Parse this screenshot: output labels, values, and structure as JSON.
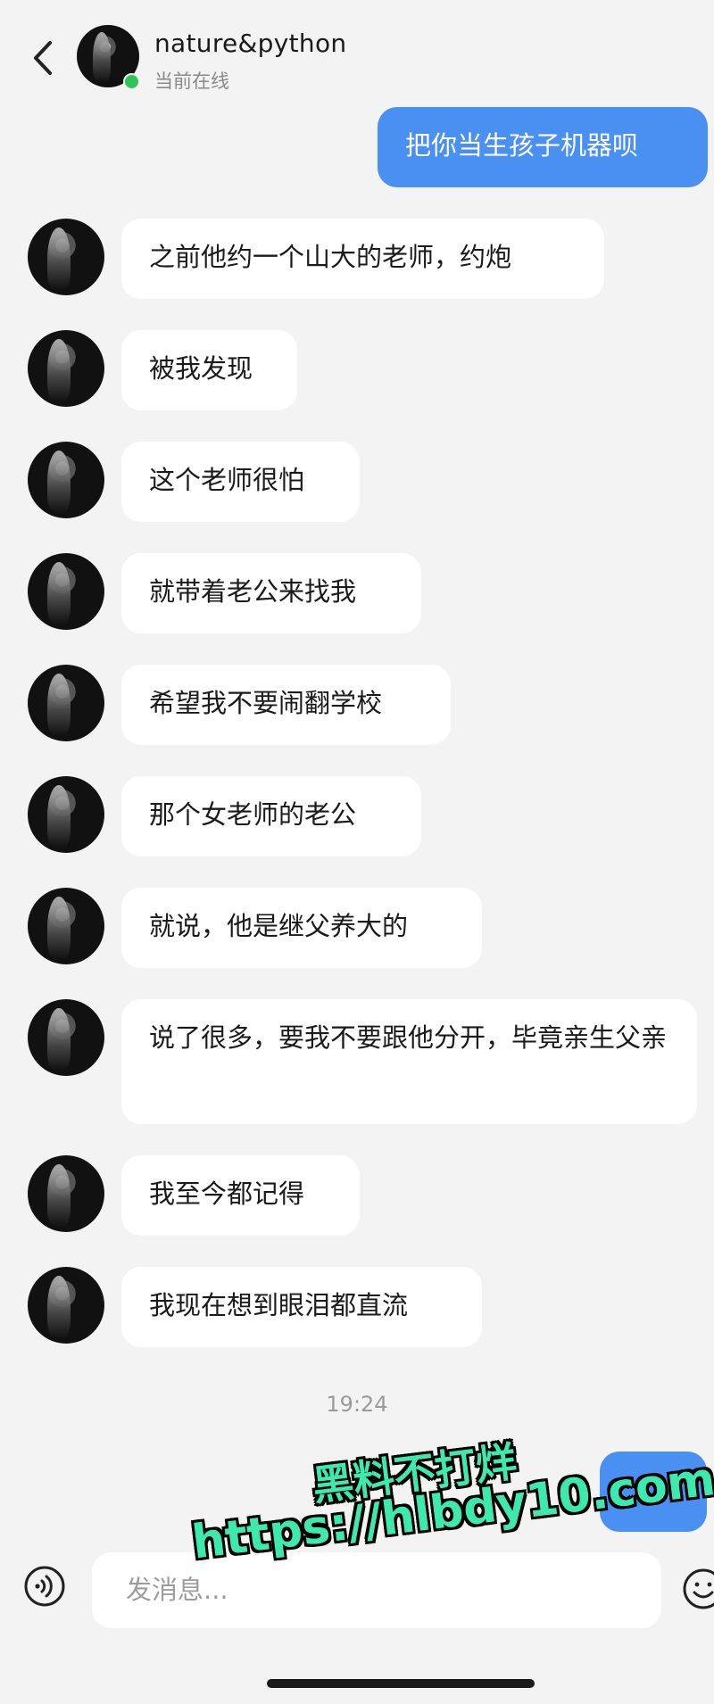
{
  "header": {
    "title": "nature&python",
    "status": "当前在线"
  },
  "messages": [
    {
      "from": "me",
      "text": "把你当生孩子机器呗"
    },
    {
      "from": "other",
      "text": "之前他约一个山大的老师，约炮"
    },
    {
      "from": "other",
      "text": "被我发现"
    },
    {
      "from": "other",
      "text": "这个老师很怕"
    },
    {
      "from": "other",
      "text": "就带着老公来找我"
    },
    {
      "from": "other",
      "text": "希望我不要闹翻学校"
    },
    {
      "from": "other",
      "text": "那个女老师的老公"
    },
    {
      "from": "other",
      "text": "就说，他是继父养大的"
    },
    {
      "from": "other",
      "text": "说了很多，要我不要跟他分开，毕竟亲生父亲"
    },
    {
      "from": "other",
      "text": "我至今都记得"
    },
    {
      "from": "other",
      "text": "我现在想到眼泪都直流"
    },
    {
      "from": "me",
      "text": ""
    }
  ],
  "timestamp": "19:24",
  "input": {
    "placeholder": "发消息..."
  },
  "watermark": {
    "line1": "黑料不打烊",
    "line2": "https://hlbdy10.com"
  },
  "colors": {
    "background": "#f3f3f3",
    "my_bubble": "#4a8ff2",
    "other_bubble": "#ffffff",
    "online": "#2fc45a",
    "watermark": "#3ee9b0"
  }
}
